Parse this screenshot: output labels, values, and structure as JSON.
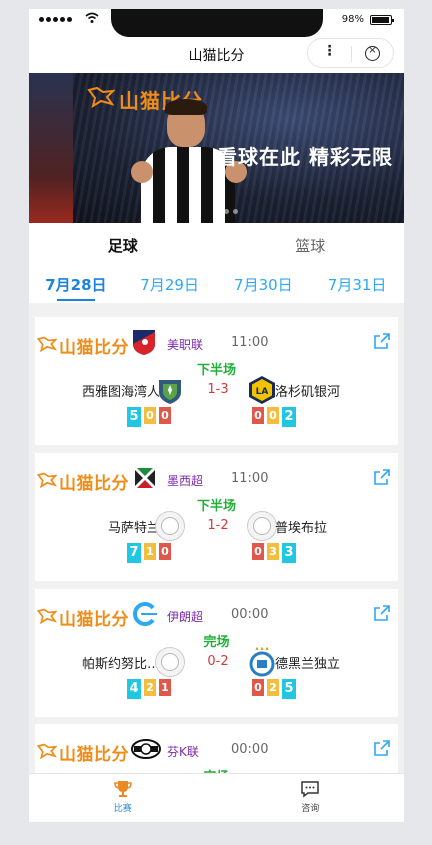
{
  "status_bar": {
    "battery_percent": "98%"
  },
  "app": {
    "title": "山猫比分",
    "more_glyph": "⋮",
    "close_glyph": "×"
  },
  "banner": {
    "brand_text": "山猫比分",
    "slogan": "看球在此 精彩无限"
  },
  "sport_tabs": [
    {
      "label": "足球",
      "active": true
    },
    {
      "label": "篮球",
      "active": false
    }
  ],
  "date_tabs": [
    {
      "label": "7月28日",
      "active": true
    },
    {
      "label": "7月29日",
      "active": false
    },
    {
      "label": "7月30日",
      "active": false
    },
    {
      "label": "7月31日",
      "active": false
    }
  ],
  "matches": [
    {
      "brand": "山猫比分",
      "league": "美职联",
      "time": "11:00",
      "status": "下半场",
      "home": "西雅图海湾人",
      "away": "洛杉矶银河",
      "score": "1-3",
      "home_stats": [
        "5",
        "0",
        "0"
      ],
      "away_stats": [
        "0",
        "0",
        "2"
      ]
    },
    {
      "brand": "山猫比分",
      "league": "墨西超",
      "time": "11:00",
      "status": "下半场",
      "home": "马萨特兰",
      "away": "普埃布拉",
      "score": "1-2",
      "home_stats": [
        "7",
        "1",
        "0"
      ],
      "away_stats": [
        "0",
        "3",
        "3"
      ]
    },
    {
      "brand": "山猫比分",
      "league": "伊朗超",
      "time": "00:00",
      "status": "完场",
      "home": "帕斯约努比…",
      "away": "德黑兰独立",
      "score": "0-2",
      "home_stats": [
        "4",
        "2",
        "1"
      ],
      "away_stats": [
        "0",
        "2",
        "5"
      ]
    },
    {
      "brand": "山猫比分",
      "league": "芬K联",
      "time": "00:00",
      "status": "完场"
    }
  ],
  "tab_bar": [
    {
      "label": "比赛",
      "icon": "trophy-icon",
      "active": true
    },
    {
      "label": "咨询",
      "icon": "chat-icon",
      "active": false
    }
  ],
  "colors": {
    "accent_blue": "#1a82e0",
    "brand_orange": "#f08c1a",
    "live_green": "#22b03a",
    "score_red": "#d23a3a"
  }
}
